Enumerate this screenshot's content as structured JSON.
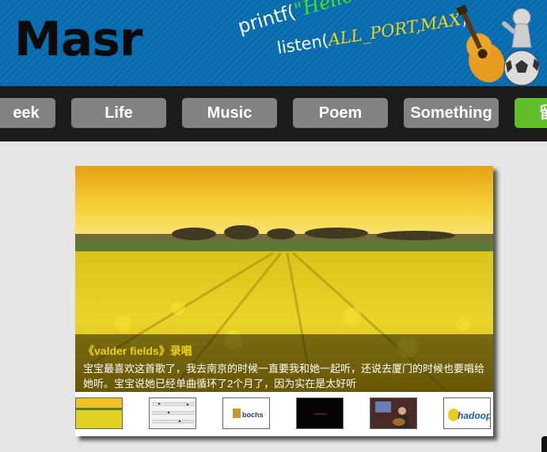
{
  "header": {
    "logo": "Masr",
    "code_line1": {
      "fn": "printf(",
      "str": "\"Hello World\"",
      "close": ")"
    },
    "code_line2": {
      "fn": "listen(",
      "args": "ALL_PORT,MAX",
      "close": ")"
    }
  },
  "nav": {
    "items": [
      {
        "label": "eek"
      },
      {
        "label": "Life"
      },
      {
        "label": "Music"
      },
      {
        "label": "Poem"
      },
      {
        "label": "Something"
      },
      {
        "label": "留"
      }
    ]
  },
  "slider": {
    "caption_title": "《valder fields》录唱",
    "caption_text": "宝宝最喜欢这首歌了，我去南京的时候一直要我和她一起听，还说去厦门的时候也要唱给她听。宝宝说她已经单曲循环了2个月了，因为实在是太好听",
    "thumbnails": [
      {
        "name": "yellow-field"
      },
      {
        "name": "sheet-music"
      },
      {
        "name": "bochs",
        "text": "bochs"
      },
      {
        "name": "dark-screen"
      },
      {
        "name": "guitar-player"
      },
      {
        "name": "hadoop",
        "text": "hadoop"
      }
    ]
  },
  "colors": {
    "header_blue": "#0b72b6",
    "nav_bg": "#1c1c1c",
    "nav_item": "#828282",
    "nav_active": "#62bf2a",
    "caption_title": "#f0d300"
  }
}
